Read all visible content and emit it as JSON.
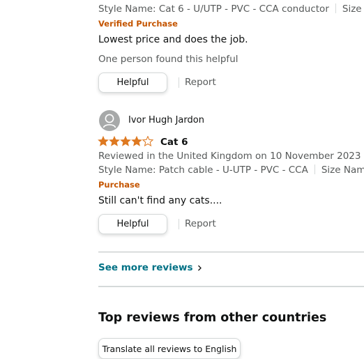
{
  "review1": {
    "style_name": "Style Name: Cat 6 - U/UTP - PVC - CCA conductor",
    "size_name": "Size Nar",
    "verified": "Verified Purchase",
    "body": "Lowest price and does the job.",
    "helpful_count": "One person found this helpful",
    "helpful_label": "Helpful",
    "report_label": "Report"
  },
  "review2": {
    "reviewer": "Ivor Hugh Jardon",
    "rating": 4,
    "title": "Cat 6",
    "reviewed_in": "Reviewed in the United Kingdom on 10 November 2023",
    "style_name": "Style Name: Patch cable - U-UTP - PVC - CCA",
    "size_name": "Size Name: (",
    "verified": "Purchase",
    "body": "Still can't find any cats....",
    "helpful_label": "Helpful",
    "report_label": "Report"
  },
  "see_more": "See more reviews",
  "section_title": "Top reviews from other countries",
  "translate_label": "Translate all reviews to English",
  "colors": {
    "star": "#de7921",
    "link": "#007185",
    "verified": "#c45500"
  },
  "icons": {
    "avatar": "avatar-icon",
    "star": "star-icon",
    "chevron": "chevron-right-icon"
  }
}
